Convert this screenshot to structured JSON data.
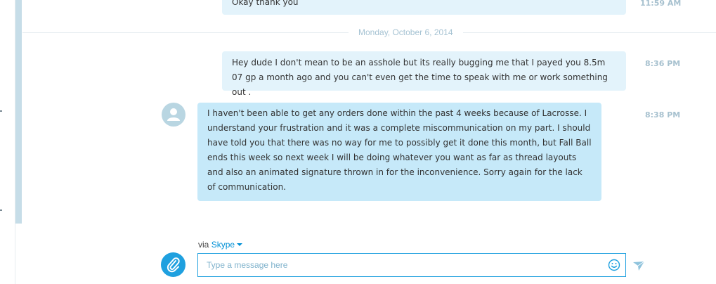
{
  "messages": [
    {
      "text": "Okay thank you",
      "time": "11:59 AM",
      "direction": "outgoing"
    },
    {
      "text": "Hey dude I don't mean to be an asshole but its really bugging me that I payed you 8.5m 07 gp a month ago and you can't even get the time to speak with me or work something out .",
      "time": "8:36 PM",
      "direction": "outgoing"
    },
    {
      "text": "I haven't been able to get any orders done within the past 4 weeks because of Lacrosse. I understand your frustration and it was a complete miscommunication on my part. I should have told you that there was no way for me to possibly get it done this month, but Fall Ball ends this week so next week I will be doing whatever you want as far as thread layouts and also an animated signature thrown in for the inconvenience. Sorry again for the lack of communication.",
      "time": "8:38 PM",
      "direction": "incoming"
    }
  ],
  "day_separator": "Monday, October 6, 2014",
  "composer": {
    "via_label": "via",
    "via_service": "Skype",
    "placeholder": "Type a message here"
  },
  "icons": {
    "attach": "paperclip-icon",
    "emoji": "smiley-icon",
    "send": "send-arrow-icon",
    "avatar": "user-avatar-icon",
    "dropdown": "caret-down-icon"
  },
  "colors": {
    "accent": "#1fa0df",
    "outgoing_bubble": "#e3f3fb",
    "incoming_bubble": "#c6e9f9",
    "timestamp": "#a7c1cf"
  }
}
